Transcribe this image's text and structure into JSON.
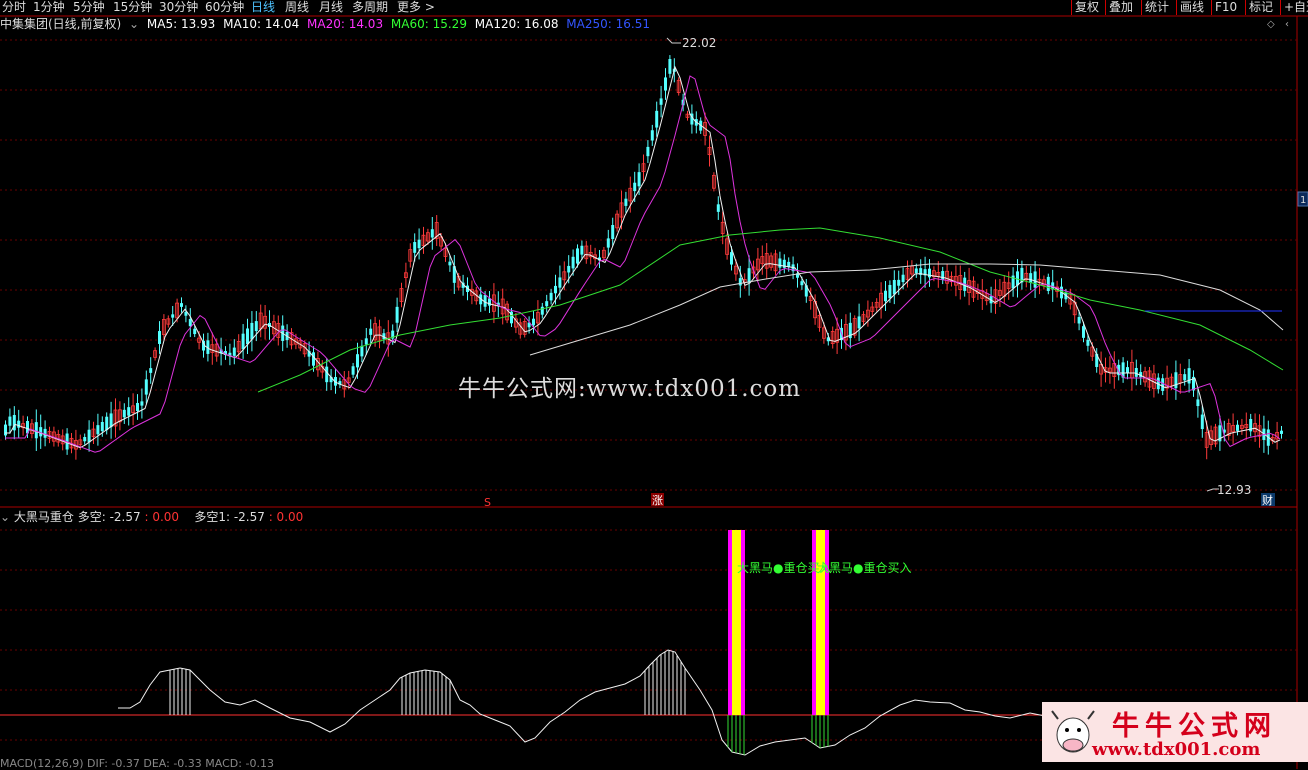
{
  "toolbar": {
    "periods": [
      "分时",
      "1分钟",
      "5分钟",
      "15分钟",
      "30分钟",
      "60分钟",
      "日线",
      "周线",
      "月线",
      "多周期",
      "更多 >"
    ],
    "active_period": "日线",
    "tools": [
      "复权",
      "叠加",
      "统计",
      "画线",
      "F10",
      "标记",
      "+自选"
    ]
  },
  "main_panel": {
    "title": "中集集团(日线,前复权)",
    "ma_labels": [
      {
        "text": "MA5: 13.93",
        "color": "#ffffff"
      },
      {
        "text": "MA10: 14.04",
        "color": "#ffffff"
      },
      {
        "text": "MA20: 14.03",
        "color": "#ff33ff"
      },
      {
        "text": "MA60: 15.29",
        "color": "#33ff33"
      },
      {
        "text": "MA120: 16.08",
        "color": "#ffffff"
      },
      {
        "text": "MA250: 16.51",
        "color": "#3355ff"
      }
    ],
    "high_label": "22.02",
    "low_label": "12.93",
    "markers": {
      "s_marker": "S",
      "zhang_marker": "涨",
      "cai_marker": "财"
    },
    "right_badge": "1"
  },
  "indicator_panel": {
    "name": "大黑马重仓",
    "value1_label": "多空: -2.57",
    "value1_extra": ": 0.00",
    "value2_label": "多空1: -2.57",
    "value2_extra": ": 0.00",
    "signal_text": "大黑马●重仓买入",
    "colors": {
      "bar_yellow": "#ffff00",
      "bar_magenta": "#ff00ff",
      "signal_green": "#33ff33"
    }
  },
  "macd_title": "MACD(12,26,9) DIF: -0.37 DEA: -0.33 MACD: -0.13",
  "watermark": "牛牛公式网:www.tdx001.com",
  "logo": {
    "text1": "牛牛公式网",
    "text2": "www.tdx001.com"
  }
}
